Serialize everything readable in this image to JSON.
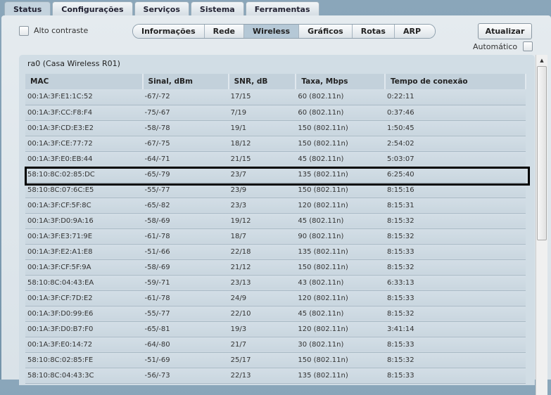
{
  "tabs": [
    "Status",
    "Configurações",
    "Serviços",
    "Sistema",
    "Ferramentas"
  ],
  "active_tab": "Status",
  "high_contrast_label": "Alto contraste",
  "subtabs": [
    "Informações",
    "Rede",
    "Wireless",
    "Gráficos",
    "Rotas",
    "ARP"
  ],
  "active_subtab": "Wireless",
  "refresh_label": "Atualizar",
  "auto_label": "Automático",
  "panel_title": "ra0 (Casa Wireless R01)",
  "columns": [
    "MAC",
    "Sinal, dBm",
    "SNR, dB",
    "Taxa, Mbps",
    "Tempo de conexão"
  ],
  "highlighted_row": 5,
  "rows": [
    [
      "00:1A:3F:E1:1C:52",
      "-67/-72",
      "17/15",
      "60 (802.11n)",
      "0:22:11"
    ],
    [
      "00:1A:3F:CC:F8:F4",
      "-75/-67",
      "7/19",
      "60 (802.11n)",
      "0:37:46"
    ],
    [
      "00:1A:3F:CD:E3:E2",
      "-58/-78",
      "19/1",
      "150 (802.11n)",
      "1:50:45"
    ],
    [
      "00:1A:3F:CE:77:72",
      "-67/-75",
      "18/12",
      "150 (802.11n)",
      "2:54:02"
    ],
    [
      "00:1A:3F:E0:EB:44",
      "-64/-71",
      "21/15",
      "45 (802.11n)",
      "5:03:07"
    ],
    [
      "58:10:8C:02:85:DC",
      "-65/-79",
      "23/7",
      "135 (802.11n)",
      "6:25:40"
    ],
    [
      "58:10:8C:07:6C:E5",
      "-55/-77",
      "23/9",
      "150 (802.11n)",
      "8:15:16"
    ],
    [
      "00:1A:3F:CF:5F:8C",
      "-65/-82",
      "23/3",
      "120 (802.11n)",
      "8:15:31"
    ],
    [
      "00:1A:3F:D0:9A:16",
      "-58/-69",
      "19/12",
      "45 (802.11n)",
      "8:15:32"
    ],
    [
      "00:1A:3F:E3:71:9E",
      "-61/-78",
      "18/7",
      "90 (802.11n)",
      "8:15:32"
    ],
    [
      "00:1A:3F:E2:A1:E8",
      "-51/-66",
      "22/18",
      "135 (802.11n)",
      "8:15:33"
    ],
    [
      "00:1A:3F:CF:5F:9A",
      "-58/-69",
      "21/12",
      "150 (802.11n)",
      "8:15:32"
    ],
    [
      "58:10:8C:04:43:EA",
      "-59/-71",
      "23/13",
      "43 (802.11n)",
      "6:33:13"
    ],
    [
      "00:1A:3F:CF:7D:E2",
      "-61/-78",
      "24/9",
      "120 (802.11n)",
      "8:15:33"
    ],
    [
      "00:1A:3F:D0:99:E6",
      "-55/-77",
      "22/10",
      "45 (802.11n)",
      "8:15:32"
    ],
    [
      "00:1A:3F:D0:B7:F0",
      "-65/-81",
      "19/3",
      "120 (802.11n)",
      "3:41:14"
    ],
    [
      "00:1A:3F:E0:14:72",
      "-64/-80",
      "21/7",
      "30 (802.11n)",
      "8:15:33"
    ],
    [
      "58:10:8C:02:85:FE",
      "-51/-69",
      "25/17",
      "150 (802.11n)",
      "8:15:32"
    ],
    [
      "58:10:8C:04:43:3C",
      "-56/-73",
      "22/13",
      "135 (802.11n)",
      "8:15:33"
    ]
  ]
}
